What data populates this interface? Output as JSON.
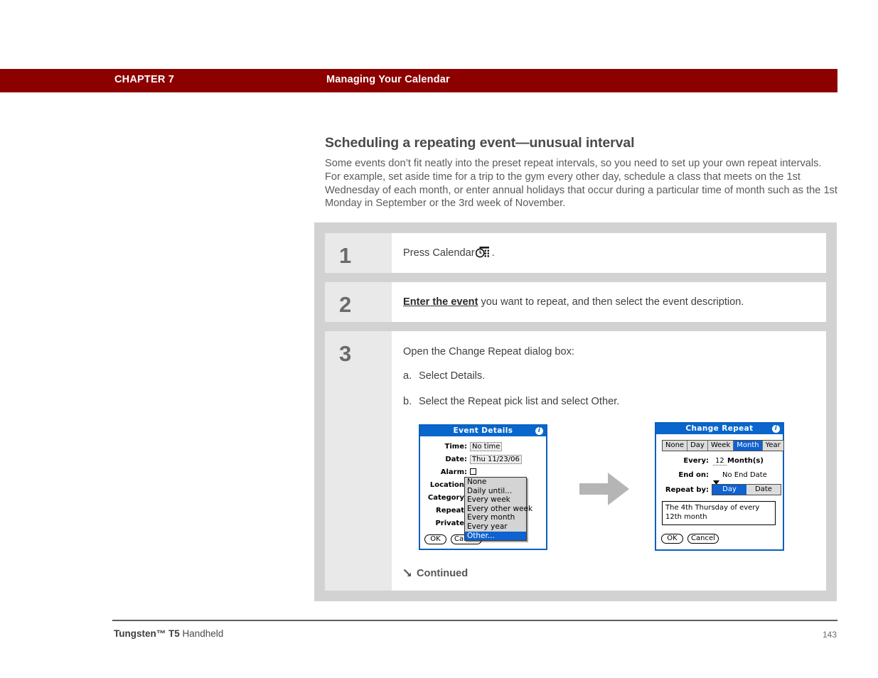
{
  "header": {
    "chapter_label": "CHAPTER 7",
    "chapter_title": "Managing Your Calendar",
    "bar_color": "#8c0000"
  },
  "section": {
    "heading": "Scheduling a repeating event—unusual interval",
    "intro": "Some events don’t fit neatly into the preset repeat intervals, so you need to set up your own repeat intervals. For example, set aside time for a trip to the gym every other day, schedule a class that meets on the 1st Wednesday of each month, or enter annual holidays that occur during a particular time of month such as the 1st Monday in September or the 3rd week of November."
  },
  "steps": [
    {
      "number": "1",
      "text_before": "Press Calendar",
      "icon": "calendar-icon",
      "text_after": "."
    },
    {
      "number": "2",
      "link_text": "Enter the event",
      "text_after": " you want to repeat, and then select the event description."
    },
    {
      "number": "3",
      "lead": "Open the Change Repeat dialog box:",
      "substeps": [
        {
          "marker": "a.",
          "text": "Select Details."
        },
        {
          "marker": "b.",
          "text": "Select the Repeat pick list and select Other."
        }
      ],
      "continued": "Continued"
    }
  ],
  "event_details_dialog": {
    "title": "Event Details",
    "info_icon": "info-icon",
    "fields": [
      {
        "label": "Time:",
        "value": "No time",
        "boxed": true
      },
      {
        "label": "Date:",
        "value": "Thu 11/23/06",
        "boxed": true
      },
      {
        "label": "Alarm:",
        "value": "",
        "checkbox": true
      },
      {
        "label": "Location:",
        "value": ""
      },
      {
        "label": "Category:",
        "value": ""
      },
      {
        "label": "Repeat:",
        "value": ""
      },
      {
        "label": "Private:",
        "value": ""
      }
    ],
    "buttons": [
      {
        "label": "OK"
      },
      {
        "label": "Cancel"
      }
    ],
    "dropdown": {
      "items": [
        "None",
        "Daily until...",
        "Every week",
        "Every other week",
        "Every month",
        "Every year",
        "Other..."
      ],
      "selected": "Other...",
      "highlight_color": "#0f62d0"
    },
    "title_color": "#0966cc"
  },
  "change_repeat_dialog": {
    "title": "Change Repeat",
    "info_icon": "info-icon",
    "tabs": [
      "None",
      "Day",
      "Week",
      "Month",
      "Year"
    ],
    "active_tab": "Month",
    "every_label": "Every:",
    "every_value": "12",
    "every_unit": "Month(s)",
    "end_on_label": "End on:",
    "end_on_value": "No End Date",
    "end_on_icon": "chevron-down-icon",
    "repeat_by_label": "Repeat by:",
    "repeat_by_options": [
      "Day",
      "Date"
    ],
    "repeat_by_active": "Day",
    "description": "The 4th Thursday of every 12th month",
    "buttons": [
      {
        "label": "OK"
      },
      {
        "label": "Cancel"
      }
    ],
    "title_color": "#0966cc"
  },
  "transition_arrow": "right-arrow-icon",
  "footer": {
    "brand": "Tungsten™ T5",
    "product": " Handheld",
    "page_number": "143"
  }
}
